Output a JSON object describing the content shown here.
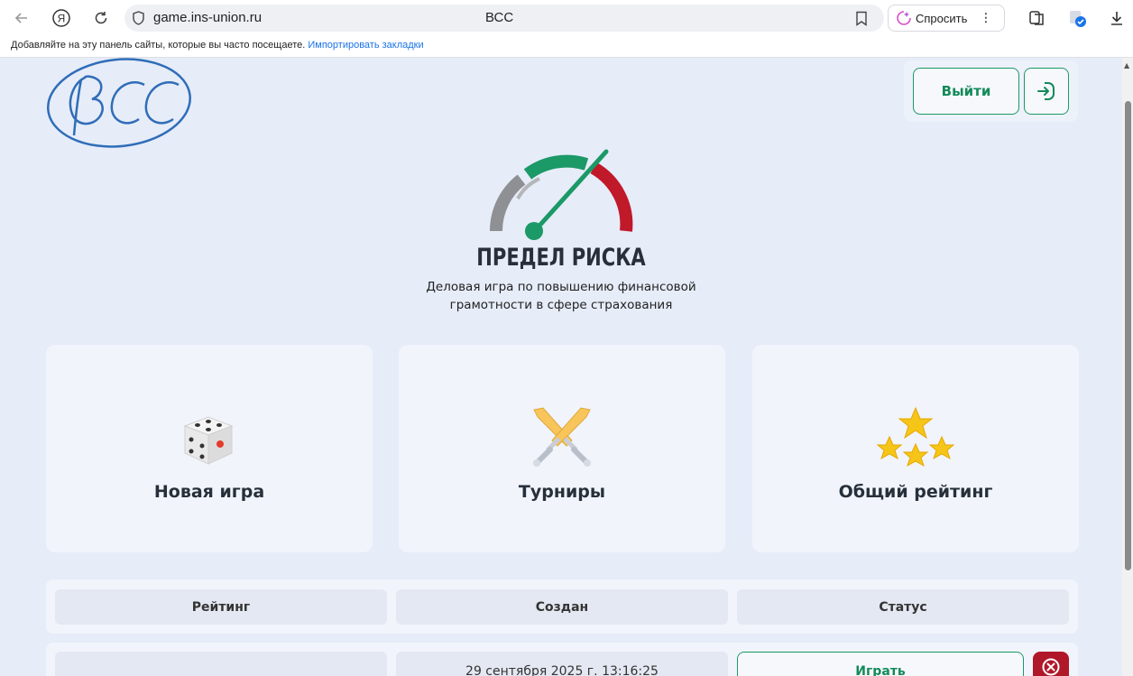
{
  "browser": {
    "url": "game.ins-union.ru",
    "tab_title": "ВСС",
    "ask_label": "Спросить",
    "bookmarks_text": "Добавляйте на эту панель сайты, которые вы часто посещаете.",
    "bookmarks_link": "Импортировать закладки"
  },
  "header": {
    "logout_label": "Выйти"
  },
  "hero": {
    "title": "ПРЕДЕЛ РИСКА",
    "subtitle_line1": "Деловая игра по повышению финансовой",
    "subtitle_line2": "грамотности в сфере страхования"
  },
  "cards": [
    {
      "label": "Новая игра",
      "icon": "dice-icon"
    },
    {
      "label": "Турниры",
      "icon": "crossed-swords-icon"
    },
    {
      "label": "Общий рейтинг",
      "icon": "stars-icon"
    }
  ],
  "table": {
    "columns": [
      "Рейтинг",
      "Создан",
      "Статус"
    ],
    "rows": [
      {
        "rating": "",
        "created": "29 сентября 2025 г. 13:16:25",
        "action": "Играть"
      }
    ]
  },
  "colors": {
    "accent_green": "#1b9966",
    "danger_red": "#b0182a",
    "brand_blue": "#2f6db8",
    "background": "#e6ecf8"
  }
}
